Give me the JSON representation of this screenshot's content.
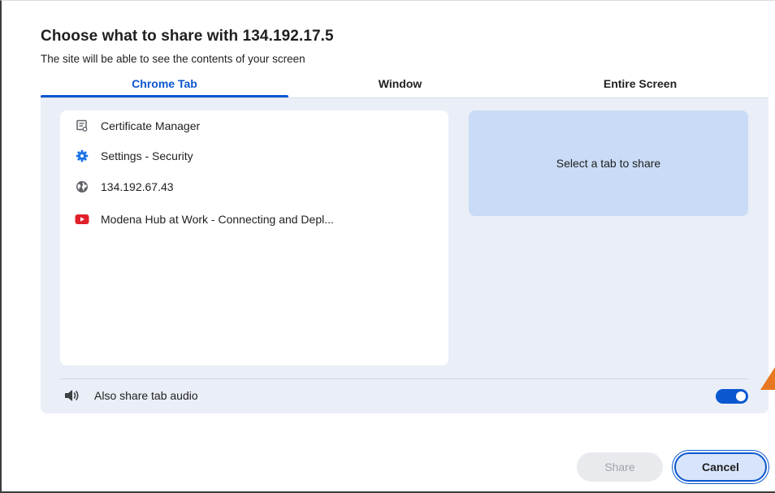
{
  "dialog": {
    "title": "Choose what to share with 134.192.17.5",
    "subtitle": "The site will be able to see the contents of your screen"
  },
  "tabs": [
    {
      "label": "Chrome Tab",
      "selected": true
    },
    {
      "label": "Window",
      "selected": false
    },
    {
      "label": "Entire Screen",
      "selected": false
    }
  ],
  "tab_list": [
    {
      "label": "Certificate Manager",
      "icon": "certificate-icon"
    },
    {
      "label": "Settings - Security",
      "icon": "settings-gear-icon"
    },
    {
      "label": "134.192.67.43",
      "icon": "globe-icon"
    },
    {
      "label": "Modena Hub at Work - Connecting and Depl...",
      "icon": "youtube-icon"
    }
  ],
  "preview": {
    "placeholder": "Select a tab to share"
  },
  "audio": {
    "label": "Also share tab audio",
    "enabled": true
  },
  "buttons": {
    "share": "Share",
    "cancel": "Cancel"
  },
  "colors": {
    "accent": "#0b57d0",
    "panel_bg": "#e9eef7",
    "preview_bg": "#c9dbf6",
    "youtube_red": "#e0202a"
  }
}
